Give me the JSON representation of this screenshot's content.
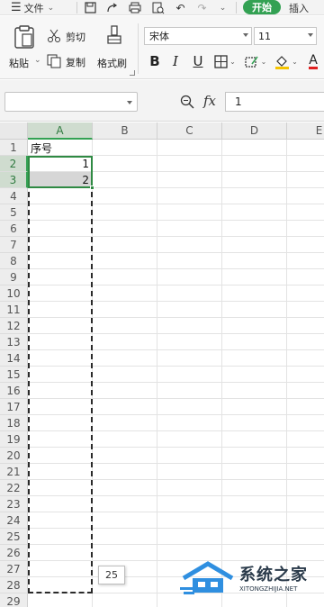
{
  "menubar": {
    "menu_label": "文件",
    "start_tab": "开始",
    "insert_tab": "插入",
    "accent": "#33a153"
  },
  "ribbon": {
    "paste_label": "粘贴",
    "cut_label": "剪切",
    "copy_label": "复制",
    "format_painter_label": "格式刷",
    "font_name": "宋体",
    "font_size": "11"
  },
  "formula_bar": {
    "name_box_value": "",
    "fx_label": "fx",
    "formula_value": "1"
  },
  "sheet": {
    "columns": [
      "A",
      "B",
      "C",
      "D",
      "E"
    ],
    "selected_column": "A",
    "rows": [
      "1",
      "2",
      "3",
      "4",
      "5",
      "6",
      "7",
      "8",
      "9",
      "10",
      "11",
      "12",
      "13",
      "14",
      "15",
      "16",
      "17",
      "18",
      "19",
      "20",
      "21",
      "22",
      "23",
      "24",
      "25",
      "26",
      "27",
      "28",
      "29"
    ],
    "selected_rows": [
      "2",
      "3"
    ],
    "cells": {
      "A1": "序号",
      "A2": "1",
      "A3": "2"
    },
    "fill_tooltip": "25",
    "selection_color": "#2f8a43"
  },
  "watermark": {
    "text": "系统之家",
    "subtext": "XITONGZHIJIA.NET"
  }
}
